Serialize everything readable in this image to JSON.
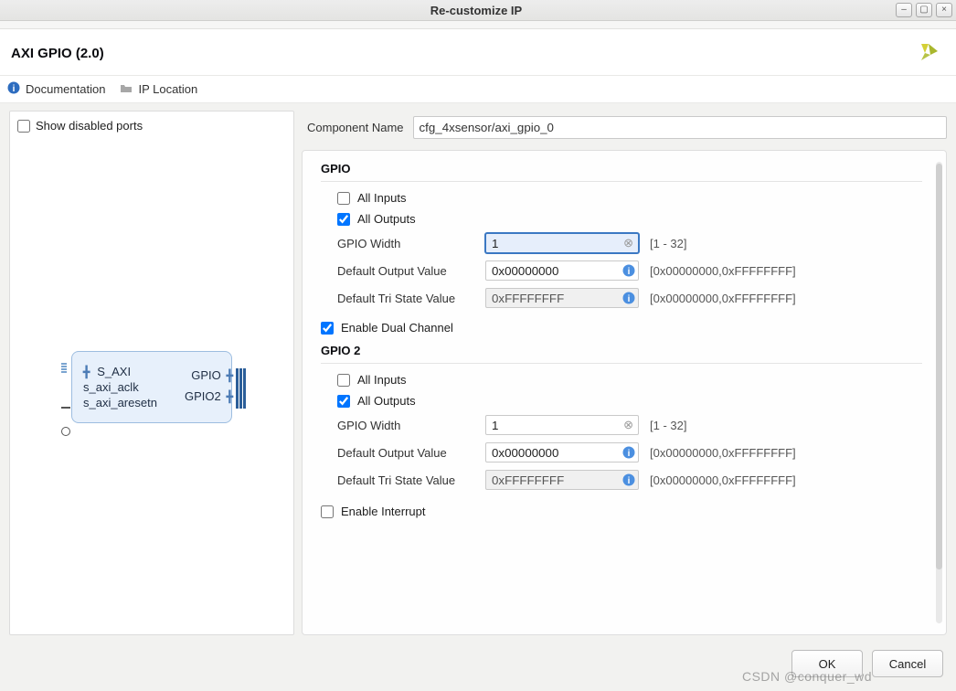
{
  "window": {
    "title": "Re-customize IP"
  },
  "header": {
    "title": "AXI GPIO (2.0)"
  },
  "toolbar": {
    "documentation": "Documentation",
    "ip_location": "IP Location"
  },
  "left_panel": {
    "show_disabled_ports_label": "Show disabled ports",
    "show_disabled_ports_checked": false,
    "block": {
      "inputs": [
        "S_AXI",
        "s_axi_aclk",
        "s_axi_aresetn"
      ],
      "outputs": [
        "GPIO",
        "GPIO2"
      ]
    }
  },
  "form": {
    "component_name_label": "Component Name",
    "component_name_value": "cfg_4xsensor/axi_gpio_0",
    "gpio": {
      "title": "GPIO",
      "all_inputs_label": "All Inputs",
      "all_inputs_checked": false,
      "all_outputs_label": "All Outputs",
      "all_outputs_checked": true,
      "width_label": "GPIO Width",
      "width_value": "1",
      "width_hint": "[1 - 32]",
      "default_output_label": "Default Output Value",
      "default_output_value": "0x00000000",
      "default_output_hint": "[0x00000000,0xFFFFFFFF]",
      "tristate_label": "Default Tri State Value",
      "tristate_value": "0xFFFFFFFF",
      "tristate_hint": "[0x00000000,0xFFFFFFFF]"
    },
    "enable_dual_label": "Enable Dual Channel",
    "enable_dual_checked": true,
    "gpio2": {
      "title": "GPIO 2",
      "all_inputs_label": "All Inputs",
      "all_inputs_checked": false,
      "all_outputs_label": "All Outputs",
      "all_outputs_checked": true,
      "width_label": "GPIO Width",
      "width_value": "1",
      "width_hint": "[1 - 32]",
      "default_output_label": "Default Output Value",
      "default_output_value": "0x00000000",
      "default_output_hint": "[0x00000000,0xFFFFFFFF]",
      "tristate_label": "Default Tri State Value",
      "tristate_value": "0xFFFFFFFF",
      "tristate_hint": "[0x00000000,0xFFFFFFFF]"
    },
    "enable_interrupt_label": "Enable Interrupt",
    "enable_interrupt_checked": false
  },
  "footer": {
    "ok": "OK",
    "cancel": "Cancel"
  },
  "watermark": "CSDN @conquer_wd"
}
